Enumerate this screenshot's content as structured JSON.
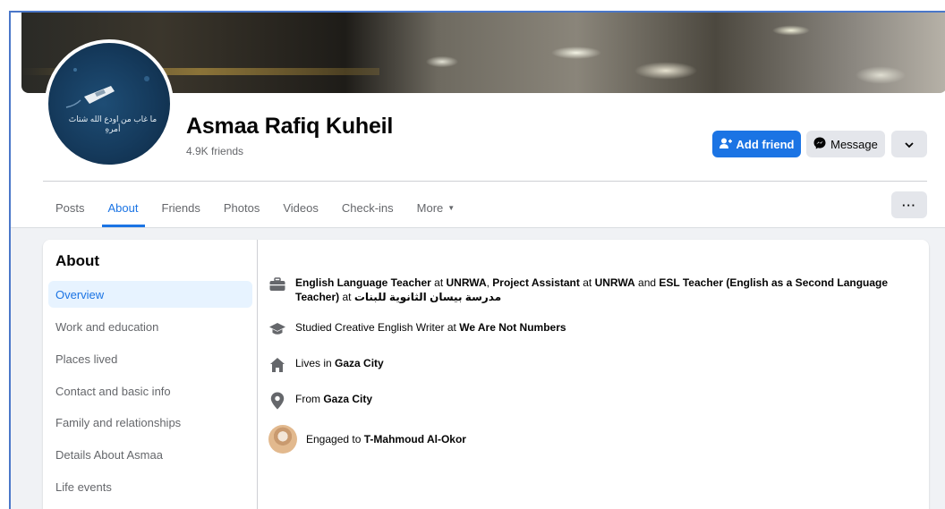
{
  "profile": {
    "name": "Asmaa Rafiq Kuheil",
    "friends": "4.9K friends",
    "avatar_text": "ما غاب من اودع الله شتاتَ أمرهِ"
  },
  "actions": {
    "add_friend": "Add friend",
    "message": "Message"
  },
  "tabs": [
    {
      "label": "Posts"
    },
    {
      "label": "About",
      "active": true
    },
    {
      "label": "Friends"
    },
    {
      "label": "Photos"
    },
    {
      "label": "Videos"
    },
    {
      "label": "Check-ins"
    },
    {
      "label": "More"
    }
  ],
  "about": {
    "title": "About",
    "sidebar": [
      {
        "label": "Overview",
        "active": true
      },
      {
        "label": "Work and education"
      },
      {
        "label": "Places lived"
      },
      {
        "label": "Contact and basic info"
      },
      {
        "label": "Family and relationships"
      },
      {
        "label": "Details About Asmaa"
      },
      {
        "label": "Life events"
      }
    ],
    "overview": {
      "work": {
        "job1": "English Language Teacher",
        "at1": " at ",
        "org1": "UNRWA",
        "sep1": ", ",
        "job2": "Project Assistant",
        "at2": " at ",
        "org2": "UNRWA",
        "and": " and ",
        "job3": "ESL Teacher (English as a Second Language Teacher)",
        "at3": " at ",
        "org3": "مدرسة بيسان الثانوية للبنات"
      },
      "education": {
        "prefix": "Studied Creative English Writer at ",
        "school": "We Are Not Numbers"
      },
      "lives": {
        "prefix": "Lives in ",
        "place": "Gaza City"
      },
      "from": {
        "prefix": "From ",
        "place": "Gaza City"
      },
      "relationship": {
        "prefix": "Engaged to ",
        "person": "T-Mahmoud Al-Okor"
      }
    }
  },
  "colors": {
    "accent": "#1b74e4",
    "active_bg": "#e7f3ff",
    "secondary_text": "#65676b",
    "button_grey": "#e4e6eb",
    "page_bg": "#f0f2f5"
  },
  "icons": {
    "work": "briefcase-icon",
    "education": "graduation-cap-icon",
    "lives": "home-icon",
    "from": "location-pin-icon",
    "add_friend": "add-person-icon",
    "message": "messenger-icon",
    "dropdown": "chevron-down-icon",
    "more_options": "ellipsis-icon"
  }
}
